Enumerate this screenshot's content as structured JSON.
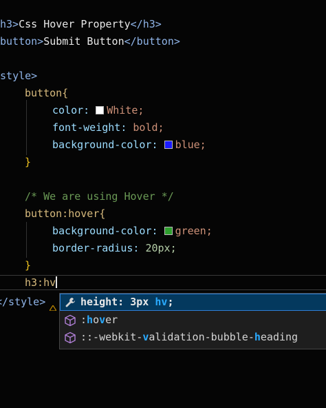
{
  "editor": {
    "line1": {
      "open": "h3>",
      "text": "Css Hover Property",
      "close": "</h3>"
    },
    "line2": {
      "open": "button>",
      "text": "Submit Button",
      "close": "</button>"
    },
    "style_open": "<style>",
    "rule1": {
      "selector": "button{",
      "color_prop": "color:",
      "color_val": "White;",
      "weight_prop": "font-weight:",
      "weight_val": "bold;",
      "bg_prop": "background-color:",
      "bg_val": "blue;",
      "close": "}"
    },
    "comment": "/* We are using Hover */",
    "rule2": {
      "selector": "button:hover{",
      "bg_prop": "background-color:",
      "bg_val": "green;",
      "radius_prop": "border-radius:",
      "radius_val": "20px;",
      "close": "}"
    },
    "current_line": "h3:hv",
    "style_close": "</style>",
    "swatch_colors": {
      "white": "#ffffff",
      "blue": "#1a1aff",
      "green": "#2e9e2e"
    }
  },
  "suggestions": [
    {
      "icon": "wrench-icon",
      "label_pre": "height: 3px ",
      "label_hl": "hv",
      "label_post": ";"
    },
    {
      "icon": "cube-icon",
      "label_pre": ":",
      "label_hl": "h",
      "label_mid": "o",
      "label_hl2": "v",
      "label_post": "er"
    },
    {
      "icon": "cube-icon",
      "label_pre": "::-webkit-",
      "label_hl": "v",
      "label_post": "alidation-bubble-",
      "label_hl2": "h",
      "label_end": "eading"
    }
  ]
}
